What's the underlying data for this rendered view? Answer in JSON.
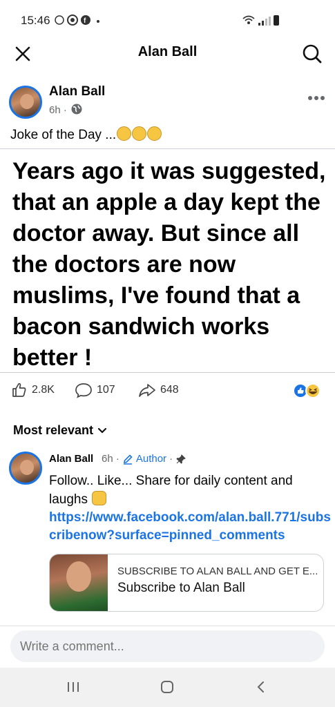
{
  "status_bar": {
    "time": "15:46"
  },
  "header": {
    "title": "Alan Ball",
    "close_icon": "close-icon",
    "search_icon": "search-icon"
  },
  "post": {
    "author": "Alan Ball",
    "time": "6h ·",
    "caption": "Joke of the Day ...",
    "caption_emojis": 3,
    "joke_text": "Years ago it was suggested, that an apple a day kept the doctor away. But since all the doctors are now muslims, I've found that a bacon sandwich works better !",
    "likes": "2.8K",
    "comments": "107",
    "shares": "648"
  },
  "comments_section": {
    "sort_label": "Most relevant",
    "comment": {
      "author": "Alan Ball",
      "time": "6h ·",
      "author_badge": "Author",
      "text": "Follow.. Like... Share for daily content and laughs",
      "link": "https://www.facebook.com/alan.ball.771/subscribenow?surface=pinned_comments",
      "card_title": "SUBSCRIBE TO ALAN BALL AND GET E...",
      "card_subtitle": "Subscribe to Alan Ball"
    }
  },
  "composer": {
    "placeholder": "Write a comment..."
  },
  "colors": {
    "accent": "#1b74e4",
    "secondary_text": "#65676b",
    "input_bg": "#f0f2f5"
  }
}
